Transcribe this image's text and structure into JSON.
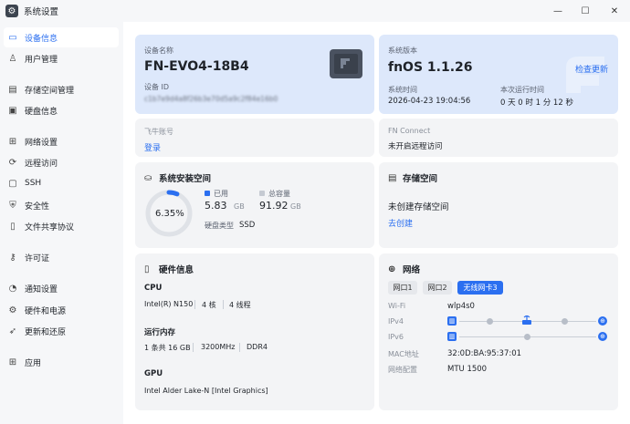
{
  "window": {
    "title": "系统设置",
    "minimize": "—",
    "maximize": "☐",
    "close": "✕"
  },
  "sidebar": {
    "items": [
      {
        "label": "设备信息",
        "icon": "monitor-icon",
        "glyph": "▭",
        "active": true
      },
      {
        "label": "用户管理",
        "icon": "user-icon",
        "glyph": "♙"
      },
      {
        "label": "存储空间管理",
        "icon": "storage-icon",
        "glyph": "▤"
      },
      {
        "label": "硬盘信息",
        "icon": "disk-icon",
        "glyph": "▣"
      },
      {
        "label": "网络设置",
        "icon": "network-icon",
        "glyph": "⊞"
      },
      {
        "label": "远程访问",
        "icon": "remote-icon",
        "glyph": "⟳"
      },
      {
        "label": "SSH",
        "icon": "ssh-icon",
        "glyph": "▢"
      },
      {
        "label": "安全性",
        "icon": "shield-icon",
        "glyph": "⛨"
      },
      {
        "label": "文件共享协议",
        "icon": "file-share-icon",
        "glyph": "▯"
      },
      {
        "label": "许可证",
        "icon": "key-icon",
        "glyph": "⚷"
      },
      {
        "label": "通知设置",
        "icon": "bell-icon",
        "glyph": "◔"
      },
      {
        "label": "硬件和电源",
        "icon": "hardware-icon",
        "glyph": "⚙"
      },
      {
        "label": "更新和还原",
        "icon": "rocket-icon",
        "glyph": "➶"
      },
      {
        "label": "应用",
        "icon": "apps-icon",
        "glyph": "⊞"
      }
    ]
  },
  "device": {
    "name_label": "设备名称",
    "name": "FN-EVO4-18B4",
    "id_label": "设备 ID",
    "id_value": "c1b7e9d4a8f26b3e70d5a9c2f84e16b0"
  },
  "system": {
    "version_label": "系统版本",
    "version": "fnOS  1.1.26",
    "check_update": "检查更新",
    "time_label": "系统时间",
    "time": "2026-04-23 19:04:56",
    "uptime_label": "本次运行时间",
    "uptime": "0 天 0 时 1 分 12 秒"
  },
  "account": {
    "label": "飞牛账号",
    "login": "登录"
  },
  "fnconnect": {
    "label": "FN Connect",
    "status": "未开启远程访问"
  },
  "sysdisk": {
    "title": "系统安装空间",
    "percent": "6.35%",
    "used_fraction": 0.0635,
    "used_label": "已用",
    "used_value": "5.83",
    "used_unit": "GB",
    "total_label": "总容量",
    "total_value": "91.92",
    "total_unit": "GB",
    "disk_type_label": "硬盘类型",
    "disk_type": "SSD",
    "accent": "#2b6ff0"
  },
  "storage": {
    "title": "存储空间",
    "status": "未创建存储空间",
    "create": "去创建"
  },
  "hardware": {
    "title": "硬件信息",
    "cpu_label": "CPU",
    "cpu_model": "Intel(R) N150",
    "cpu_cores": "4 核",
    "cpu_threads": "4 线程",
    "mem_label": "运行内存",
    "mem_slots": "1 条共 16 GB",
    "mem_speed": "3200MHz",
    "mem_type": "DDR4",
    "gpu_label": "GPU",
    "gpu_model": "Intel Alder Lake-N [Intel Graphics]"
  },
  "network": {
    "title": "网络",
    "tabs": [
      "网口1",
      "网口2",
      "无线网卡3"
    ],
    "active_tab": 2,
    "wifi_label": "Wi-Fi",
    "wifi_value": "wlp4s0",
    "ipv4_label": "IPv4",
    "ipv6_label": "IPv6",
    "mac_label": "MAC地址",
    "mac_value": "32:0D:BA:95:37:01",
    "netcfg_label": "网络配置",
    "netcfg_value": "MTU 1500"
  }
}
